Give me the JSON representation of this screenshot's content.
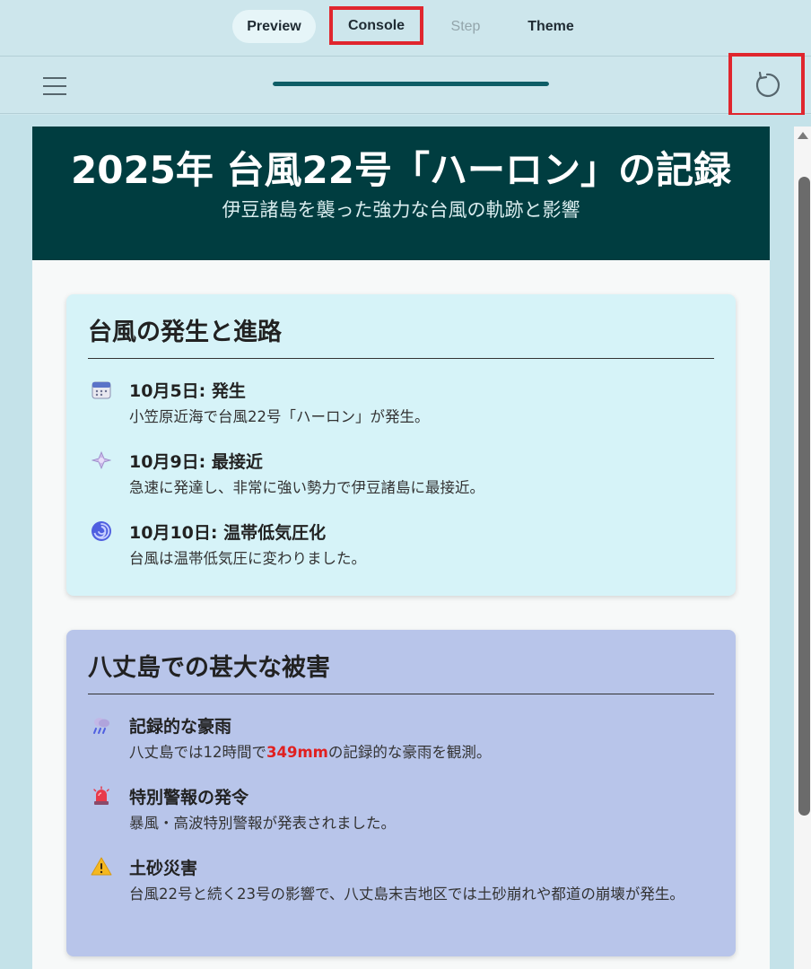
{
  "tabs": {
    "preview": "Preview",
    "console": "Console",
    "step": "Step",
    "theme": "Theme"
  },
  "toolbar": {
    "progress": 1.0
  },
  "hero": {
    "title": "2025年 台風22号「ハーロン」の記録",
    "subtitle": "伊豆諸島を襲った強力な台風の軌跡と影響"
  },
  "section1": {
    "title": "台風の発生と進路",
    "items": [
      {
        "icon": "calendar-icon",
        "title": "10月5日: 発生",
        "text": "小笠原近海で台風22号「ハーロン」が発生。"
      },
      {
        "icon": "sparkle-storm-icon",
        "title": "10月9日: 最接近",
        "text": "急速に発達し、非常に強い勢力で伊豆諸島に最接近。"
      },
      {
        "icon": "cyclone-icon",
        "title": "10月10日: 温帯低気圧化",
        "text": "台風は温帯低気圧に変わりました。"
      }
    ]
  },
  "section2": {
    "title": "八丈島での甚大な被害",
    "items": [
      {
        "icon": "rain-cloud-icon",
        "title": "記録的な豪雨",
        "text_before": "八丈島では12時間で",
        "highlight": "349mm",
        "text_after": "の記録的な豪雨を観測。"
      },
      {
        "icon": "siren-icon",
        "title": "特別警報の発令",
        "text": "暴風・高波特別警報が発表されました。"
      },
      {
        "icon": "warning-icon",
        "title": "土砂災害",
        "text": "台風22号と続く23号の影響で、八丈島末吉地区では土砂崩れや都道の崩壊が発生。"
      }
    ]
  },
  "colors": {
    "hero_bg": "#003d40",
    "card1_bg": "#d6f3f8",
    "card2_bg": "#b8c5ea",
    "highlight": "#e02020",
    "accent": "#0e5d66"
  }
}
